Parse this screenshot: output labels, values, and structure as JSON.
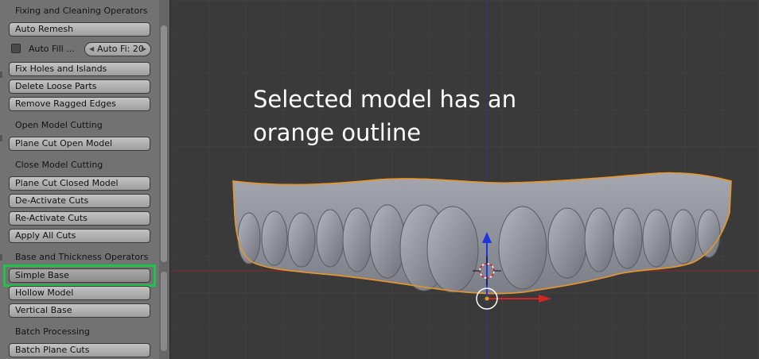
{
  "panel": {
    "sections": [
      {
        "title": "Fixing and Cleaning Operators"
      },
      {
        "title": "Open Model Cutting"
      },
      {
        "title": "Close Model Cutting"
      },
      {
        "title": "Base and Thickness Operators"
      },
      {
        "title": "Batch Processing"
      }
    ],
    "buttons": {
      "auto_remesh": "Auto Remesh",
      "fix_holes": "Fix Holes and Islands",
      "delete_loose": "Delete Loose Parts",
      "remove_ragged": "Remove Ragged Edges",
      "plane_cut_open": "Plane Cut Open Model",
      "plane_cut_closed": "Plane Cut Closed Model",
      "deactivate_cuts": "De-Activate Cuts",
      "reactivate_cuts": "Re-Activate Cuts",
      "apply_all_cuts": "Apply All Cuts",
      "simple_base": "Simple Base",
      "hollow_model": "Hollow Model",
      "vertical_base": "Vertical Base",
      "batch_plane_cuts": "Batch Plane Cuts"
    },
    "auto_fill": {
      "checkbox_label": "Auto Fill ...",
      "field_text": "Auto Fi: 20"
    }
  },
  "viewport": {
    "annotation": "Selected model has an\norange outline",
    "colors": {
      "selection_outline": "#e8952a",
      "x_axis": "#c42626",
      "z_axis": "#1f34e0",
      "mesh": "#8d8f98",
      "highlight": "#1ec34a"
    }
  }
}
